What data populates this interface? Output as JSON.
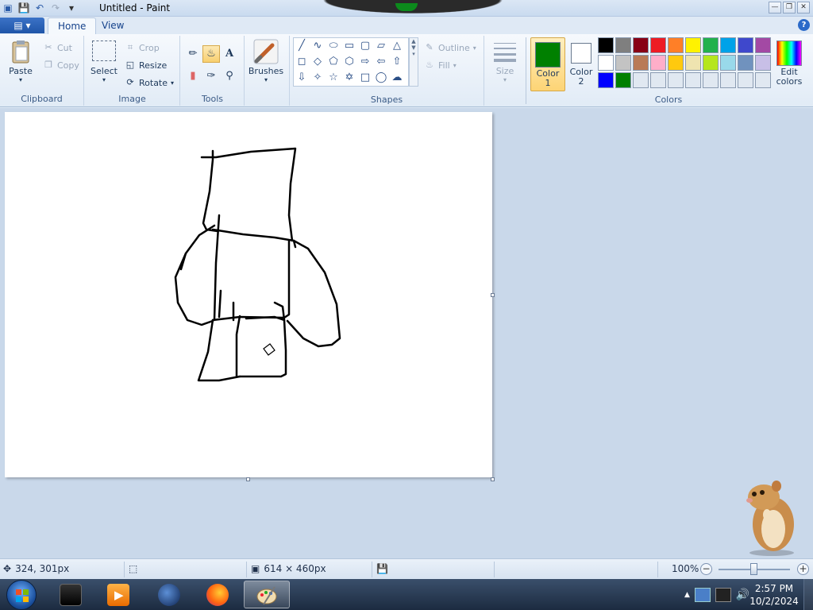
{
  "window": {
    "title": "Untitled - Paint",
    "controls": [
      "minimize",
      "restore",
      "close"
    ]
  },
  "quick_access": [
    "paint-menu-icon",
    "save-icon",
    "undo-icon",
    "redo-icon",
    "customize-dropdown-icon"
  ],
  "tabs": [
    {
      "label": "Home",
      "active": true
    },
    {
      "label": "View",
      "active": false
    }
  ],
  "ribbon": {
    "clipboard": {
      "label": "Clipboard",
      "paste": "Paste",
      "cut": "Cut",
      "copy": "Copy"
    },
    "image": {
      "label": "Image",
      "select": "Select",
      "crop": "Crop",
      "resize": "Resize",
      "rotate": "Rotate"
    },
    "tools": {
      "label": "Tools",
      "items": [
        "pencil-icon",
        "fill-icon",
        "text-icon",
        "eraser-icon",
        "color-picker-icon",
        "magnifier-icon"
      ],
      "active": "fill-icon"
    },
    "brushes": {
      "label": "Brushes"
    },
    "shapes": {
      "label": "Shapes",
      "outline": "Outline",
      "fill": "Fill"
    },
    "size": {
      "label": "Size"
    },
    "colors": {
      "label": "Colors",
      "color1": {
        "label_line1": "Color",
        "label_line2": "1",
        "value": "#008000"
      },
      "color2": {
        "label_line1": "Color",
        "label_line2": "2",
        "value": "#ffffff"
      },
      "edit": {
        "label_line1": "Edit",
        "label_line2": "colors"
      },
      "palette_row1": [
        "#000000",
        "#7f7f7f",
        "#880015",
        "#ed1c24",
        "#ff7f27",
        "#fff200",
        "#22b14c",
        "#00a2e8",
        "#3f48cc",
        "#a349a4"
      ],
      "palette_row2": [
        "#ffffff",
        "#c3c3c3",
        "#b97a57",
        "#ffaec9",
        "#ffc90e",
        "#efe4b0",
        "#b5e61d",
        "#99d9ea",
        "#7092be",
        "#c8bfe7"
      ],
      "palette_row3": [
        "#0000ff",
        "#008000",
        "#e0e8f1",
        "#e0e8f1",
        "#e0e8f1",
        "#e0e8f1",
        "#e0e8f1",
        "#e0e8f1",
        "#e0e8f1",
        "#e0e8f1"
      ]
    }
  },
  "status": {
    "cursor_pos": "324, 301px",
    "image_size": "614 × 460px",
    "zoom": "100%",
    "zoom_percent": 100
  },
  "taskbar": {
    "apps": [
      "terminal-app-icon",
      "media-player-app-icon",
      "browser-globe-app-icon",
      "firefox-app-icon",
      "paint-app-icon"
    ],
    "active_app": "paint-app-icon",
    "time": "2:57 PM",
    "date": "10/2/2024"
  }
}
